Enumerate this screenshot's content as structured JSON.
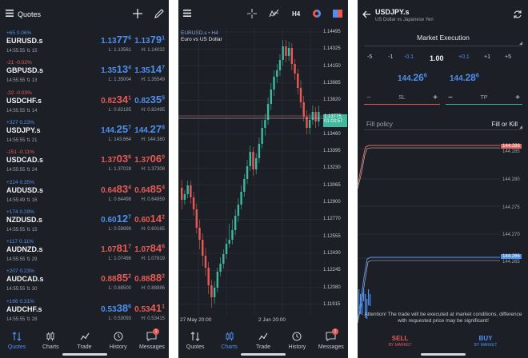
{
  "quotes_screen": {
    "title": "Quotes",
    "rows": [
      {
        "change": "+65 0.06%",
        "dir": "up",
        "symbol": "EURUSD.s",
        "time": "14:55:55",
        "spread": "15",
        "bid_pre": "1.13",
        "bid_big": "77",
        "bid_sup": "6",
        "ask_pre": "1.13",
        "ask_big": "79",
        "ask_sup": "1",
        "low": "L: 1.13561",
        "high": "H: 1.14032",
        "bid_dir": "up",
        "ask_dir": "up"
      },
      {
        "change": "-21 -0.02%",
        "dir": "dn",
        "symbol": "GBPUSD.s",
        "time": "14:55:55",
        "spread": "13",
        "bid_pre": "1.35",
        "bid_big": "13",
        "bid_sup": "4",
        "ask_pre": "1.35",
        "ask_big": "14",
        "ask_sup": "7",
        "low": "L: 1.35004",
        "high": "H: 1.35549",
        "bid_dir": "up",
        "ask_dir": "up"
      },
      {
        "change": "-22 -0.03%",
        "dir": "dn",
        "symbol": "USDCHF.s",
        "time": "14:55:55",
        "spread": "14",
        "bid_pre": "0.82",
        "bid_big": "34",
        "bid_sup": "1",
        "ask_pre": "0.82",
        "ask_big": "35",
        "ask_sup": "5",
        "low": "L: 0.82185",
        "high": "H: 0.82495",
        "bid_dir": "dn",
        "ask_dir": "up"
      },
      {
        "change": "+327 0.23%",
        "dir": "up",
        "symbol": "USDJPY.s",
        "time": "14:55:55",
        "spread": "21",
        "bid_pre": "144.",
        "bid_big": "25",
        "bid_sup": "7",
        "ask_pre": "144.",
        "ask_big": "27",
        "ask_sup": "8",
        "low": "L: 143.664",
        "high": "H: 144.380",
        "bid_dir": "up",
        "ask_dir": "up"
      },
      {
        "change": "-151 -0.11%",
        "dir": "dn",
        "symbol": "USDCAD.s",
        "time": "14:55:55",
        "spread": "24",
        "bid_pre": "1.37",
        "bid_big": "03",
        "bid_sup": "6",
        "ask_pre": "1.37",
        "ask_big": "06",
        "ask_sup": "0",
        "low": "L: 1.37028",
        "high": "H: 1.37308",
        "bid_dir": "dn",
        "ask_dir": "dn"
      },
      {
        "change": "+224 0.35%",
        "dir": "up",
        "symbol": "AUDUSD.s",
        "time": "14:55:49",
        "spread": "16",
        "bid_pre": "0.64",
        "bid_big": "83",
        "bid_sup": "4",
        "ask_pre": "0.64",
        "ask_big": "85",
        "ask_sup": "4",
        "low": "L: 0.64498",
        "high": "H: 0.64859",
        "bid_dir": "dn",
        "ask_dir": "dn"
      },
      {
        "change": "+174 0.29%",
        "dir": "up",
        "symbol": "NZDUSD.s",
        "time": "14:55:55",
        "spread": "15",
        "bid_pre": "0.60",
        "bid_big": "12",
        "bid_sup": "7",
        "ask_pre": "0.60",
        "ask_big": "14",
        "ask_sup": "2",
        "low": "L: 0.59899",
        "high": "H: 0.60165",
        "bid_dir": "up",
        "ask_dir": "dn"
      },
      {
        "change": "+117 0.11%",
        "dir": "up",
        "symbol": "AUDNZD.s",
        "time": "14:55:55",
        "spread": "29",
        "bid_pre": "1.07",
        "bid_big": "81",
        "bid_sup": "7",
        "ask_pre": "1.07",
        "ask_big": "84",
        "ask_sup": "6",
        "low": "L: 1.07498",
        "high": "H: 1.07819",
        "bid_dir": "dn",
        "ask_dir": "dn"
      },
      {
        "change": "+207 0.23%",
        "dir": "up",
        "symbol": "AUDCAD.s",
        "time": "14:55:55",
        "spread": "30",
        "bid_pre": "0.88",
        "bid_big": "85",
        "bid_sup": "2",
        "ask_pre": "0.88",
        "ask_big": "88",
        "ask_sup": "2",
        "low": "L: 0.88500",
        "high": "H: 0.88886",
        "bid_dir": "dn",
        "ask_dir": "dn"
      },
      {
        "change": "+166 0.31%",
        "dir": "up",
        "symbol": "AUDCHF.s",
        "time": "14:55:55",
        "spread": "28",
        "bid_pre": "0.53",
        "bid_big": "38",
        "bid_sup": "6",
        "ask_pre": "0.53",
        "ask_big": "41",
        "ask_sup": "1",
        "low": "L: 0.53093",
        "high": "H: 0.53415",
        "bid_dir": "up",
        "ask_dir": "dn"
      }
    ]
  },
  "nav": {
    "items": [
      "Quotes",
      "Charts",
      "Trade",
      "History",
      "Messages"
    ],
    "badge": "1"
  },
  "chart_screen": {
    "timeframe": "H4",
    "symbol_line": "EURUSD.s • H4",
    "description": "Euro vs US Dollar",
    "price_tag": "1.13775",
    "countdown_tag": "01:03:57",
    "y_labels": [
      "1.14495",
      "1.14325",
      "1.14150",
      "1.13985",
      "1.13820",
      "1.13650",
      "1.13460",
      "1.13395",
      "1.13230",
      "1.13065",
      "1.12900",
      "1.12770",
      "1.12555",
      "1.12430",
      "1.12245",
      "1.12080",
      "1.11915"
    ],
    "x_labels": [
      "27 May 20:00",
      "2 Jun 20:00"
    ]
  },
  "trade_screen": {
    "symbol": "USDJPY.s",
    "description": "US Dollar vs Japanese Yen",
    "execution": "Market Execution",
    "volume_steps": [
      "-5",
      "-1",
      "-0.1",
      "1.00",
      "+0.1",
      "+1",
      "+5"
    ],
    "sell_price_pre": "144.",
    "sell_price_big": "26",
    "sell_price_sup": "6",
    "buy_price_pre": "144.",
    "buy_price_big": "28",
    "buy_price_sup": "6",
    "sl_label": "SL",
    "tp_label": "TP",
    "fill_policy_label": "Fill policy",
    "fill_policy_value": "Fill or Kill",
    "price_labels": {
      "ask_top": "144.286",
      "bid_top": "144.285",
      "l1": "144.280",
      "l2": "144.275",
      "l3": "144.270",
      "ask_bot": "144.266",
      "bid_bot": "144.265"
    },
    "warning": "Attention! The trade will be executed at market conditions, difference with requested price may be significant!",
    "sell_label": "SELL",
    "sell_sub": "BY MARKET",
    "buy_label": "BUY",
    "buy_sub": "BY MARKET"
  },
  "colors": {
    "up": "#4e8ff0",
    "down": "#e75a56",
    "bull_candle": "#3fb8a0",
    "bear_candle": "#e75a56",
    "accent_line": "#e6685d"
  }
}
